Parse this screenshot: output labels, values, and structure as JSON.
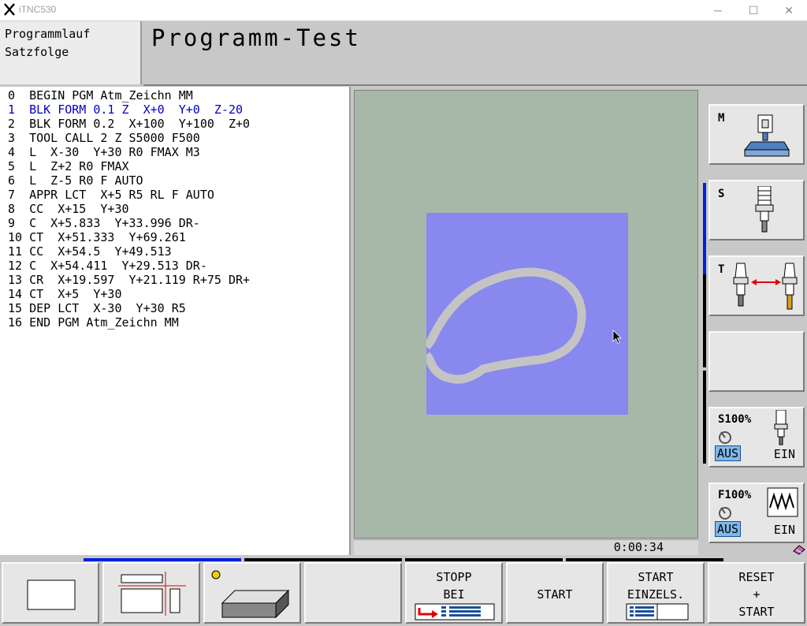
{
  "window": {
    "title": "iTNC530",
    "minimize_glyph": "─",
    "maximize_glyph": "☐",
    "close_glyph": "✕"
  },
  "mode": {
    "line1": "Programmlauf",
    "line2": "Satzfolge"
  },
  "header": {
    "title": "Programm-Test"
  },
  "program": {
    "lines": [
      "0  BEGIN PGM Atm_Zeichn MM",
      "1  BLK FORM 0.1 Z  X+0  Y+0  Z-20",
      "2  BLK FORM 0.2  X+100  Y+100  Z+0",
      "3  TOOL CALL 2 Z S5000 F500",
      "4  L  X-30  Y+30 R0 FMAX M3",
      "5  L  Z+2 R0 FMAX",
      "6  L  Z-5 R0 F AUTO",
      "7  APPR LCT  X+5 R5 RL F AUTO",
      "8  CC  X+15  Y+30",
      "9  C  X+5.833  Y+33.996 DR-",
      "10 CT  X+51.333  Y+69.261",
      "11 CC  X+54.5  Y+49.513",
      "12 C  X+54.411  Y+29.513 DR-",
      "13 CR  X+19.597  Y+21.119 R+75 DR+",
      "14 CT  X+5  Y+30",
      "15 DEP LCT  X-30  Y+30 R5",
      "16 END PGM Atm_Zeichn MM"
    ],
    "active_line": 1
  },
  "status": {
    "run_time": "0:00:34"
  },
  "side": {
    "m_label": "M",
    "s_label": "S",
    "t_label": "T",
    "spindle_override": "S100%",
    "feed_override": "F100%",
    "aus": "AUS",
    "ein": "EIN"
  },
  "softkeys": {
    "stopp_line1": "STOPP",
    "stopp_line2": "BEI",
    "start": "START",
    "start_single_line1": "START",
    "start_single_line2": "EINZELS.",
    "reset_line1": "RESET",
    "reset_line2": "+",
    "reset_line3": "START"
  },
  "colors": {
    "active_line": "#0000c8",
    "blank": "#8888ee",
    "graphic_background": "#a8b8a8",
    "toolpath": "#c4c4c4",
    "indicator_active": "#0020e0",
    "aus_highlight": "#7fb8e8"
  }
}
